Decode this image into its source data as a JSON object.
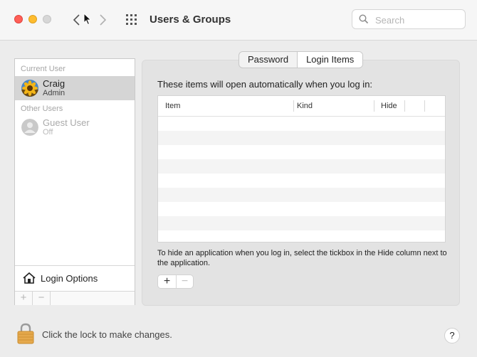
{
  "window": {
    "title": "Users & Groups",
    "search_placeholder": "Search"
  },
  "sidebar": {
    "current_user_label": "Current User",
    "other_users_label": "Other Users",
    "current_user": {
      "name": "Craig",
      "role": "Admin"
    },
    "other_users": [
      {
        "name": "Guest User",
        "role": "Off"
      }
    ],
    "login_options_label": "Login Options",
    "add_label": "+",
    "remove_label": "−"
  },
  "tabs": [
    {
      "label": "Password",
      "active": false
    },
    {
      "label": "Login Items",
      "active": true
    }
  ],
  "login_items": {
    "heading": "These items will open automatically when you log in:",
    "columns": [
      "Item",
      "Kind",
      "Hide"
    ],
    "rows": [],
    "help_text": "To hide an application when you log in, select the tickbox in the Hide column next to the application.",
    "add_label": "+",
    "remove_label": "−"
  },
  "footer": {
    "lock_text": "Click the lock to make changes.",
    "help_label": "?"
  },
  "colors": {
    "close": "#ff5f57",
    "minimize": "#febc2e",
    "zoom_inactive": "#d7d7d7",
    "selection": "#d5d5d5",
    "lock": "#e5a94d"
  }
}
